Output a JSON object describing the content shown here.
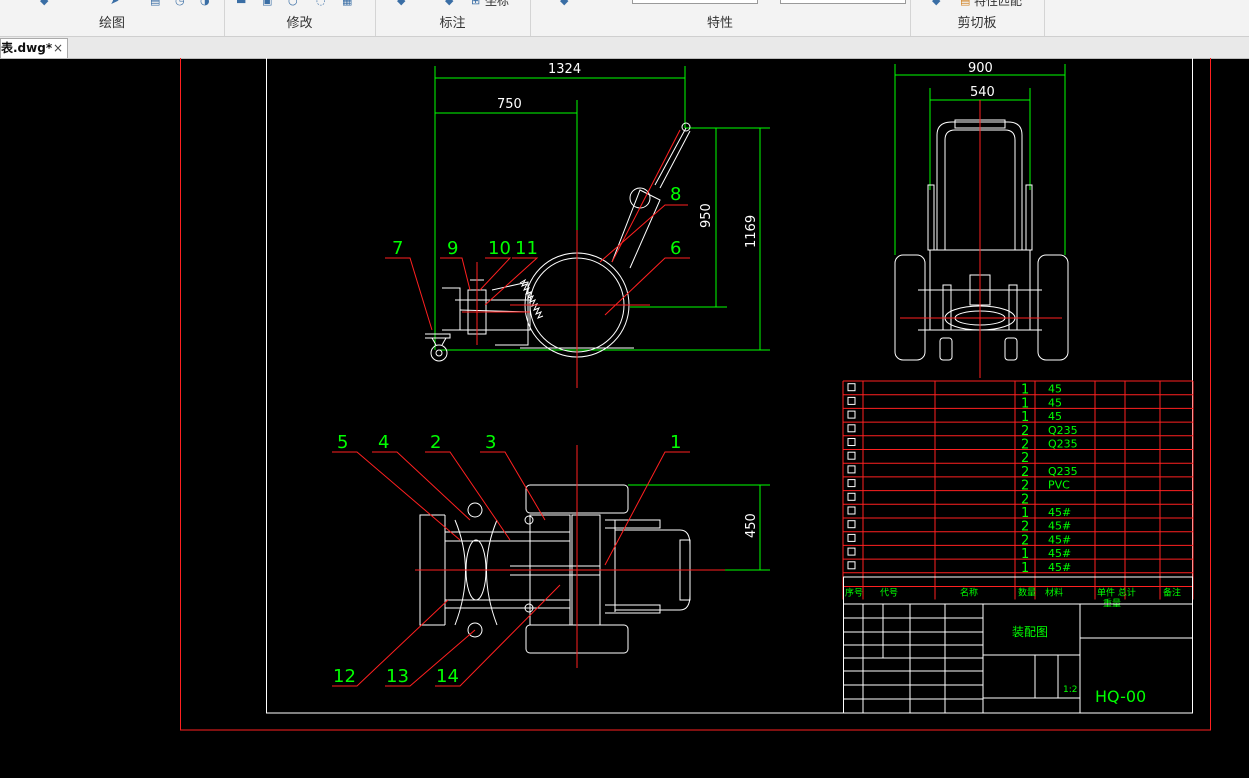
{
  "ribbon": {
    "groups": [
      {
        "label": "绘图"
      },
      {
        "label": "修改"
      },
      {
        "label": "标注"
      },
      {
        "label": "特性"
      },
      {
        "label": "剪切板"
      }
    ],
    "clipped_button": "特性匹配",
    "clipped_dim_button": "坐标"
  },
  "tab": {
    "label": "表.dwg*",
    "close": "×"
  },
  "drawing": {
    "dims": {
      "d1324": "1324",
      "d750": "750",
      "d950": "950",
      "d1169": "1169",
      "d900": "900",
      "d540": "540",
      "d450": "450"
    },
    "balloons": {
      "b1": "1",
      "b2": "2",
      "b3": "3",
      "b4": "4",
      "b5": "5",
      "b6": "6",
      "b7": "7",
      "b8": "8",
      "b9": "9",
      "b10": "10",
      "b11": "11",
      "b12": "12",
      "b13": "13",
      "b14": "14"
    },
    "bom_rows": [
      {
        "qty": "1",
        "mat": "45"
      },
      {
        "qty": "1",
        "mat": "45"
      },
      {
        "qty": "1",
        "mat": "45"
      },
      {
        "qty": "2",
        "mat": "Q235"
      },
      {
        "qty": "2",
        "mat": "Q235"
      },
      {
        "qty": "2",
        "mat": ""
      },
      {
        "qty": "2",
        "mat": "Q235"
      },
      {
        "qty": "2",
        "mat": "PVC"
      },
      {
        "qty": "2",
        "mat": ""
      },
      {
        "qty": "1",
        "mat": "45#"
      },
      {
        "qty": "2",
        "mat": "45#"
      },
      {
        "qty": "2",
        "mat": "45#"
      },
      {
        "qty": "1",
        "mat": "45#"
      },
      {
        "qty": "1",
        "mat": "45#"
      }
    ],
    "bom_header": {
      "seq": "序号",
      "code": "代号",
      "name": "名称",
      "qty": "数量",
      "mat": "材料",
      "unit_total": "单件 总计",
      "weight": "重量",
      "note": "备注"
    },
    "title_block": {
      "drawing_name": "装配图",
      "drawing_no": "HQ-00",
      "scale_val": "1:2"
    }
  }
}
